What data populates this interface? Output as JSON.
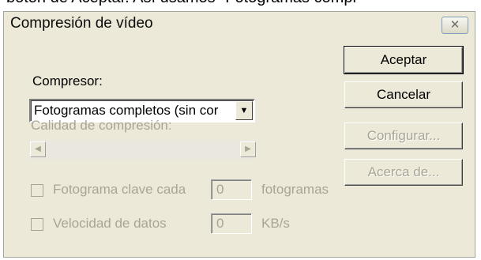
{
  "caption_fragment": "botón de Aceptar. Así usamos \"Fotogramas compl",
  "window": {
    "title": "Compresión de vídeo",
    "close_glyph": "✕"
  },
  "compressor": {
    "label": "Compresor:",
    "selected": "Fotogramas completos (sin cor",
    "arrow_glyph": "▼"
  },
  "quality": {
    "label": "Calidad de compresión:",
    "left_glyph": "◀",
    "right_glyph": "▶"
  },
  "keyframe": {
    "label": "Fotograma clave cada",
    "value": "0",
    "unit": "fotogramas"
  },
  "datarate": {
    "label": "Velocidad de datos",
    "value": "0",
    "unit": "KB/s"
  },
  "buttons": {
    "accept": "Aceptar",
    "cancel": "Cancelar",
    "configure": "Configurar...",
    "about": "Acerca de..."
  }
}
